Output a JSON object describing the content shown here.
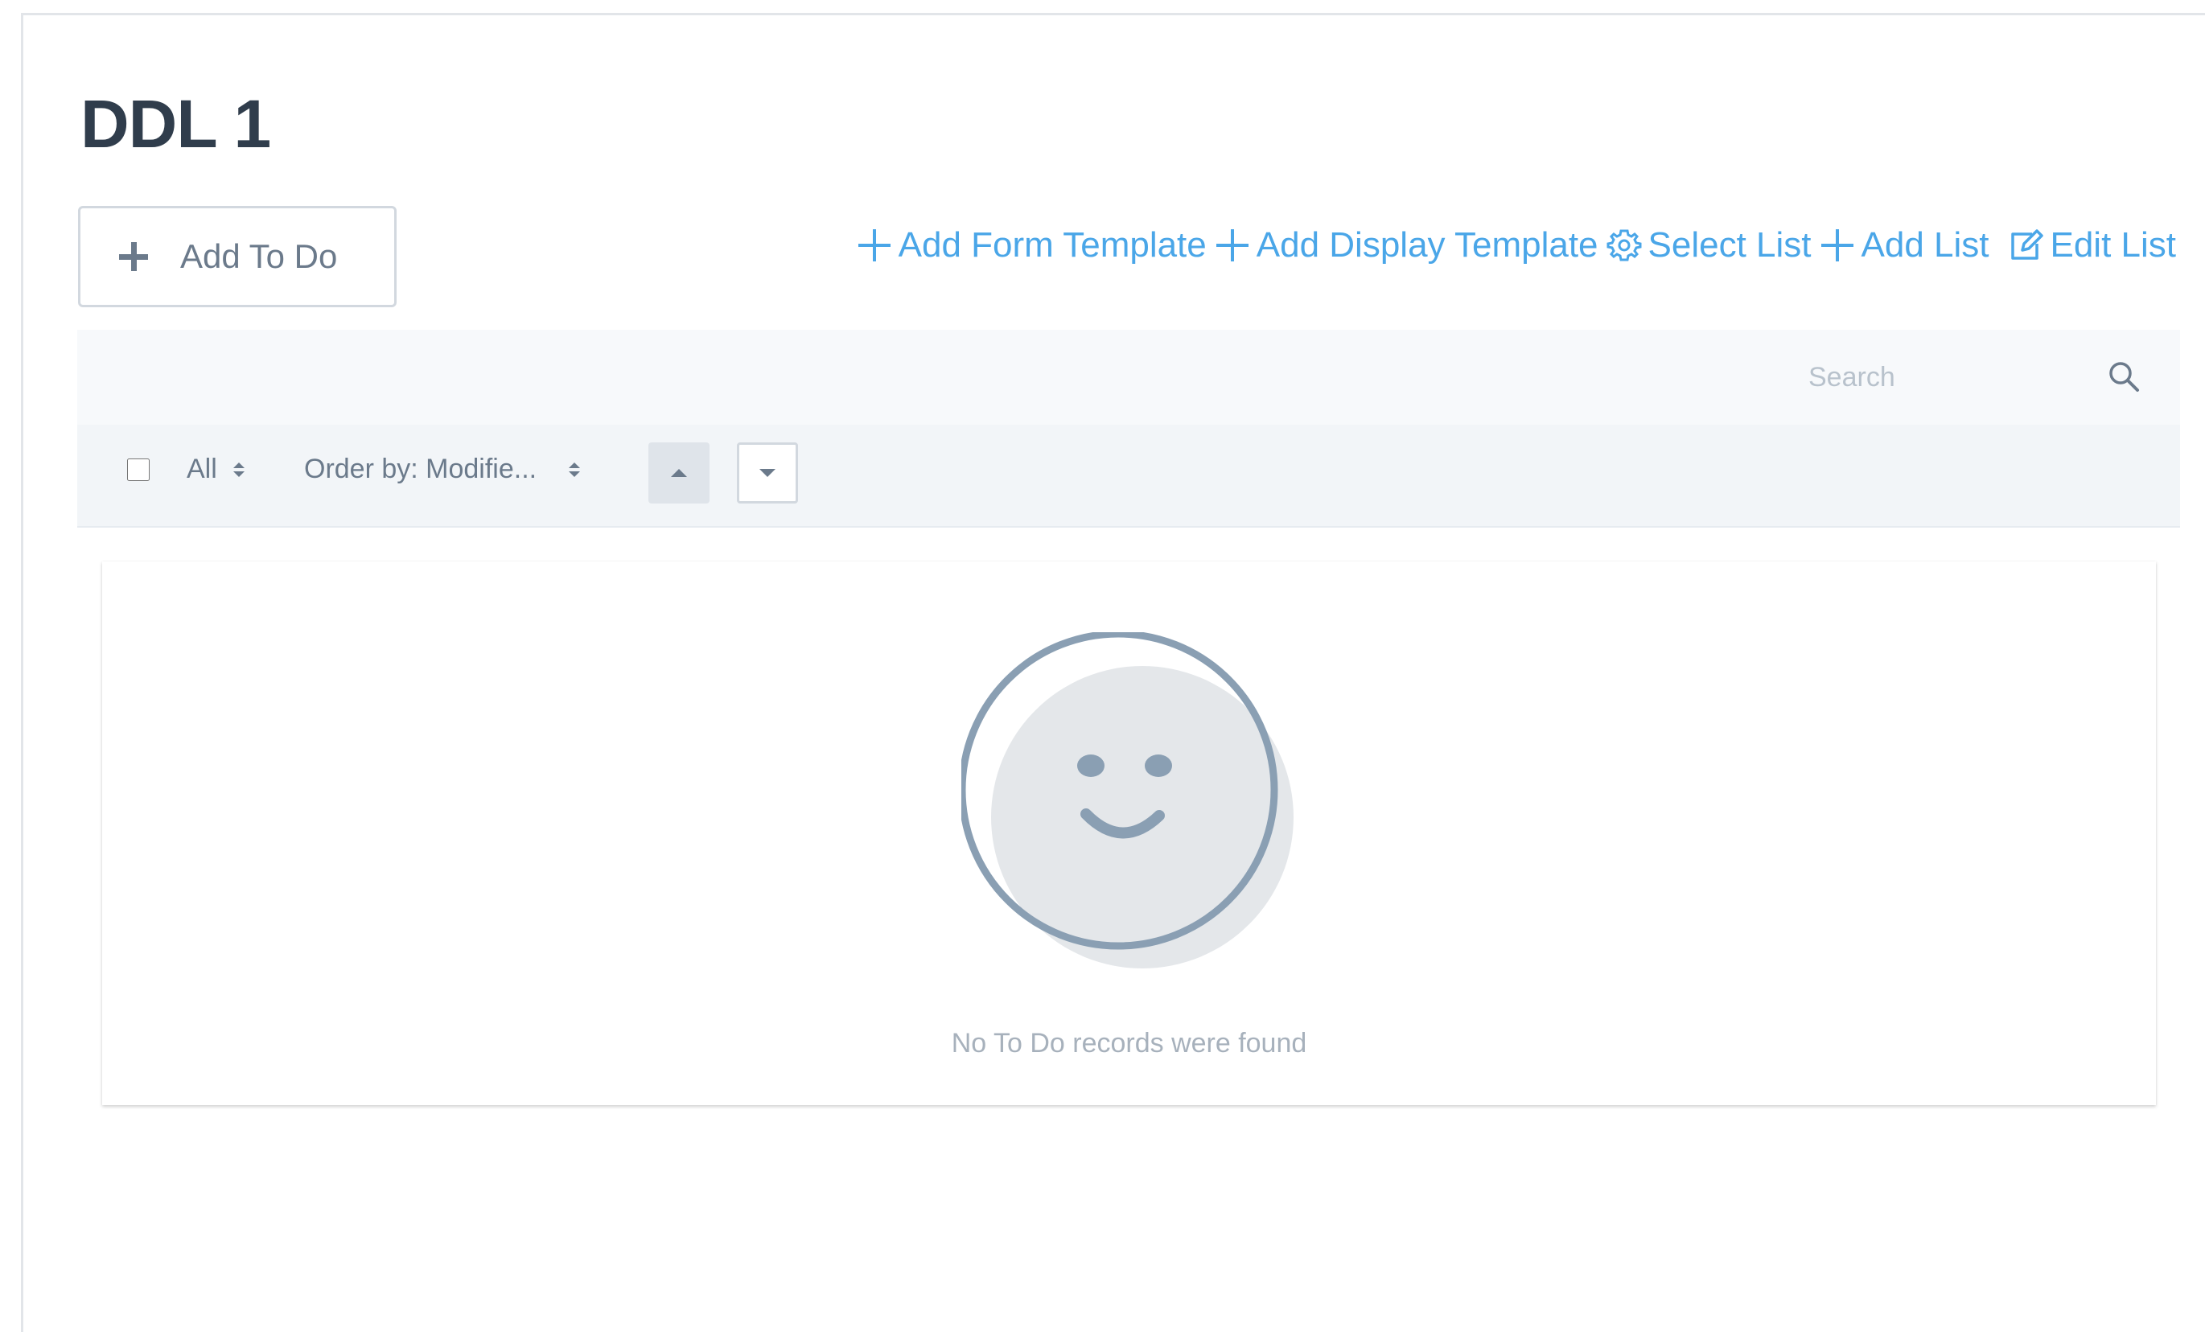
{
  "page": {
    "title": "DDL 1"
  },
  "actions": {
    "add_todo_label": "Add To Do"
  },
  "toolbar": {
    "links": [
      {
        "label": "Add Form Template",
        "icon": "plus-icon"
      },
      {
        "label": "Add Display Template",
        "icon": "plus-icon"
      },
      {
        "label": "Select List",
        "icon": "gear-icon"
      },
      {
        "label": "Add List",
        "icon": "plus-icon"
      },
      {
        "label": "Edit List",
        "icon": "edit-icon"
      }
    ],
    "link_color": "#4aa6e8"
  },
  "search": {
    "placeholder": "Search",
    "value": ""
  },
  "management_bar": {
    "filter_label": "All",
    "order_label": "Order by: Modifie...",
    "select_all_checked": false
  },
  "empty_state": {
    "message": "No To Do records were found",
    "illustration": "smiley-face-icon"
  },
  "colors": {
    "title": "#303d4c",
    "secondary_text": "#6b7a8b",
    "accent": "#4aa6e8",
    "bar_background": "#f2f5f8"
  }
}
